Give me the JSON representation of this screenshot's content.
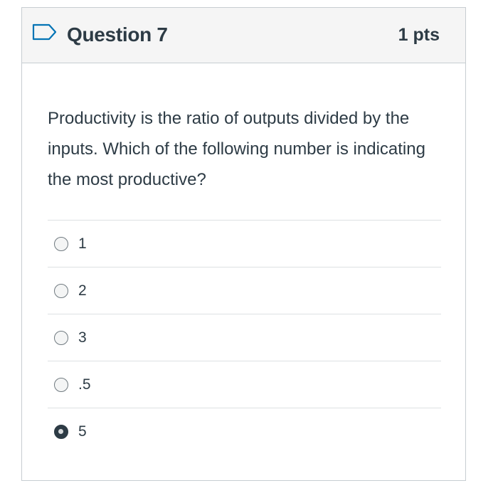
{
  "question": {
    "title": "Question 7",
    "points": "1 pts",
    "text": "Productivity is the ratio of outputs divided by the inputs. Which of the following number is indicating the most productive?",
    "flag_icon": "flag-outline-icon"
  },
  "answers": [
    {
      "label": "1",
      "selected": false
    },
    {
      "label": "2",
      "selected": false
    },
    {
      "label": "3",
      "selected": false
    },
    {
      "label": ".5",
      "selected": false
    },
    {
      "label": "5",
      "selected": true
    }
  ],
  "colors": {
    "text": "#2d3b45",
    "header_bg": "#f5f5f5",
    "border": "#c7cdd1",
    "divider": "#dde1e3"
  }
}
